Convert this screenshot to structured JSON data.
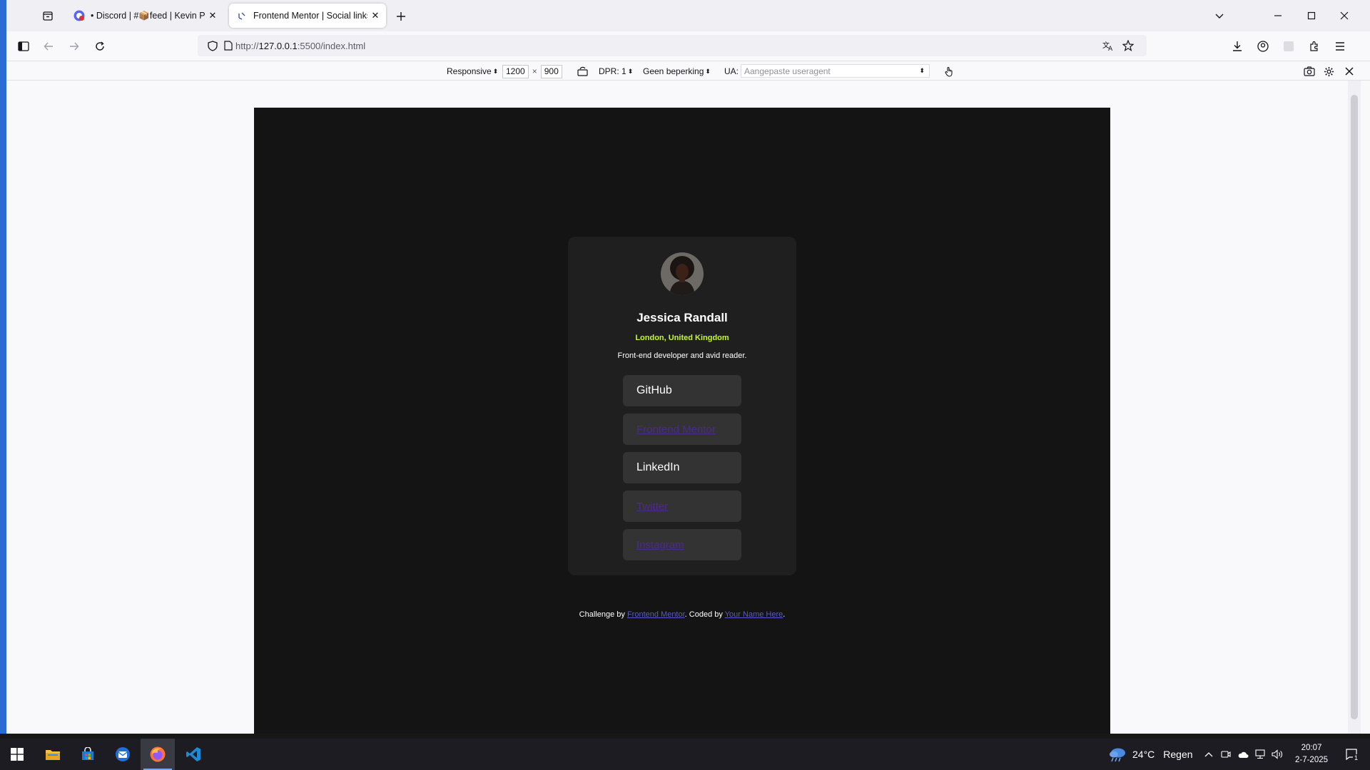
{
  "browser": {
    "tabs": [
      {
        "label": "• Discord | #📦feed | Kevin Pow",
        "active": false
      },
      {
        "label": "Frontend Mentor | Social links p",
        "active": true
      }
    ],
    "url": {
      "prefix": "http://",
      "host": "127.0.0.1",
      "rest": ":5500/index.html"
    }
  },
  "rdm": {
    "device": "Responsive",
    "width": "1200",
    "times": "×",
    "height": "900",
    "dpr": "DPR: 1",
    "throttle": "Geen beperking",
    "ua_label": "UA:",
    "ua_placeholder": "Aangepaste useragent"
  },
  "profile": {
    "name": "Jessica Randall",
    "location": "London, United Kingdom",
    "bio": "Front-end developer and avid reader.",
    "links": [
      {
        "label": "GitHub",
        "style": "button"
      },
      {
        "label": "Frontend Mentor",
        "style": "anchor"
      },
      {
        "label": "LinkedIn",
        "style": "button"
      },
      {
        "label": "Twitter",
        "style": "anchor"
      },
      {
        "label": "Instagram",
        "style": "anchor"
      }
    ]
  },
  "footer": {
    "prefix": "Challenge by ",
    "link1": "Frontend Mentor",
    "middle": ". Coded by ",
    "link2": "Your Name Here",
    "suffix": "."
  },
  "taskbar": {
    "weather_temp": "24°C",
    "weather_text": "Regen",
    "time": "20:07",
    "date": "2-7-2025",
    "notification_count": "1"
  },
  "colors": {
    "page_bg": "#141414",
    "card_bg": "#1f1f1f",
    "button_bg": "#333333",
    "location": "#c4f82a",
    "visited_link": "#4b2a8e"
  }
}
